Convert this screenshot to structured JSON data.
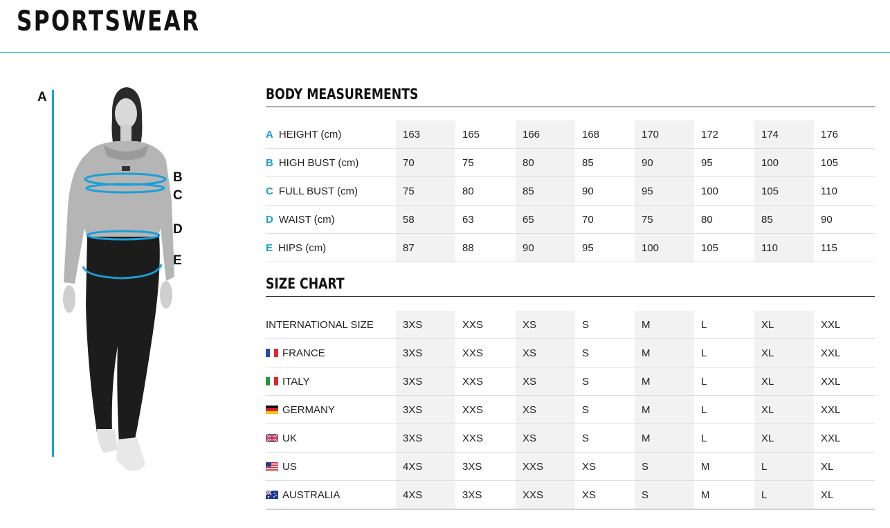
{
  "page_title": "SPORTSWEAR",
  "figure_labels": [
    "A",
    "B",
    "C",
    "D",
    "E"
  ],
  "body_measurements": {
    "title": "BODY MEASUREMENTS",
    "rows": [
      {
        "letter": "A",
        "label": "HEIGHT (cm)",
        "values": [
          "163",
          "165",
          "166",
          "168",
          "170",
          "172",
          "174",
          "176"
        ]
      },
      {
        "letter": "B",
        "label": "HIGH BUST (cm)",
        "values": [
          "70",
          "75",
          "80",
          "85",
          "90",
          "95",
          "100",
          "105"
        ]
      },
      {
        "letter": "C",
        "label": "FULL BUST (cm)",
        "values": [
          "75",
          "80",
          "85",
          "90",
          "95",
          "100",
          "105",
          "110"
        ]
      },
      {
        "letter": "D",
        "label": "WAIST (cm)",
        "values": [
          "58",
          "63",
          "65",
          "70",
          "75",
          "80",
          "85",
          "90"
        ]
      },
      {
        "letter": "E",
        "label": "HIPS (cm)",
        "values": [
          "87",
          "88",
          "90",
          "95",
          "100",
          "105",
          "110",
          "115"
        ]
      }
    ]
  },
  "size_chart": {
    "title": "SIZE CHART",
    "rows": [
      {
        "flag": "",
        "label": "INTERNATIONAL SIZE",
        "values": [
          "3XS",
          "XXS",
          "XS",
          "S",
          "M",
          "L",
          "XL",
          "XXL"
        ]
      },
      {
        "flag": "france-flag-icon",
        "label": "FRANCE",
        "values": [
          "3XS",
          "XXS",
          "XS",
          "S",
          "M",
          "L",
          "XL",
          "XXL"
        ]
      },
      {
        "flag": "italy-flag-icon",
        "label": "ITALY",
        "values": [
          "3XS",
          "XXS",
          "XS",
          "S",
          "M",
          "L",
          "XL",
          "XXL"
        ]
      },
      {
        "flag": "germany-flag-icon",
        "label": "GERMANY",
        "values": [
          "3XS",
          "XXS",
          "XS",
          "S",
          "M",
          "L",
          "XL",
          "XXL"
        ]
      },
      {
        "flag": "uk-flag-icon",
        "label": "UK",
        "values": [
          "3XS",
          "XXS",
          "XS",
          "S",
          "M",
          "L",
          "XL",
          "XXL"
        ]
      },
      {
        "flag": "us-flag-icon",
        "label": "US",
        "values": [
          "4XS",
          "3XS",
          "XXS",
          "XS",
          "S",
          "M",
          "L",
          "XL"
        ]
      },
      {
        "flag": "australia-flag-icon",
        "label": "AUSTRALIA",
        "values": [
          "4XS",
          "3XS",
          "XXS",
          "XS",
          "S",
          "M",
          "L",
          "XL"
        ]
      }
    ]
  },
  "colors": {
    "accent": "#1a9fd8",
    "shade": "#f2f2f2",
    "text": "#222222"
  }
}
